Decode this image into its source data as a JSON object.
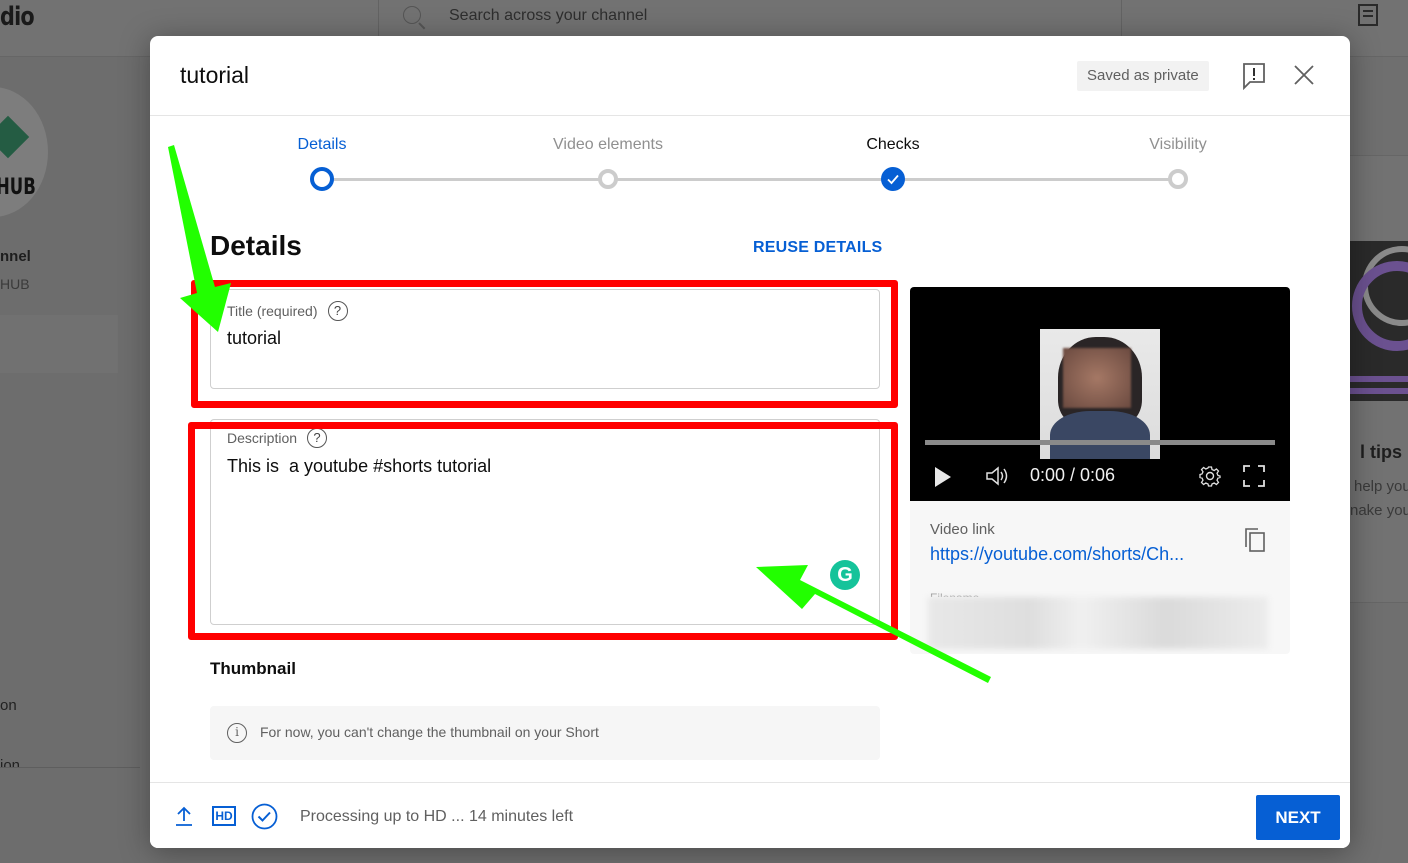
{
  "background": {
    "logo_text": "dio",
    "search_placeholder": "Search across your channel",
    "channel_avatar_text": "HUB",
    "channel_name": "nnel",
    "channel_sub": "HUB",
    "sidebar_item_1": "on",
    "sidebar_item_2": "ion",
    "right_panel_title": "l tips",
    "right_panel_line1": "help you",
    "right_panel_line2": "nake you"
  },
  "dialog": {
    "title": "tutorial",
    "saved_badge": "Saved as private",
    "stepper": [
      {
        "label": "Details",
        "state": "active"
      },
      {
        "label": "Video elements",
        "state": "todo"
      },
      {
        "label": "Checks",
        "state": "done"
      },
      {
        "label": "Visibility",
        "state": "todo"
      }
    ],
    "section_title": "Details",
    "reuse_details": "REUSE DETAILS",
    "title_field": {
      "label": "Title (required)",
      "value": "tutorial",
      "help": "?"
    },
    "description_field": {
      "label": "Description",
      "value": "This is  a youtube #shorts tutorial",
      "help": "?"
    },
    "grammarly_glyph": "G",
    "thumbnail": {
      "title": "Thumbnail",
      "info_glyph": "i",
      "note": "For now, you can't change the thumbnail on your Short"
    },
    "video": {
      "time": "0:00 / 0:06",
      "link_label": "Video link",
      "link_value": "https://youtube.com/shorts/Ch...",
      "file_label": "Filename"
    },
    "footer": {
      "hd_label": "HD",
      "status": "Processing up to HD ... 14 minutes left",
      "next_label": "NEXT"
    }
  },
  "colors": {
    "accent": "#065fd4",
    "annotation_red": "#ff0000",
    "annotation_green": "#22ff00",
    "grammarly": "#15c39a"
  }
}
